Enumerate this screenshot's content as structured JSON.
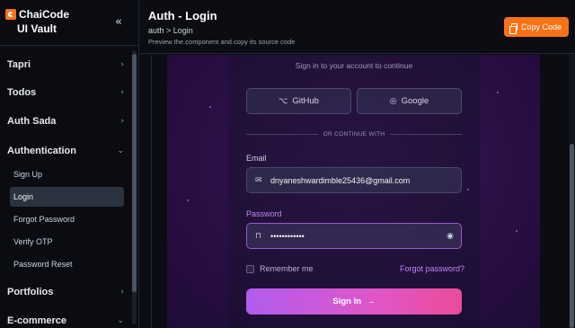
{
  "sidebar": {
    "brand_name": "ChaiCode",
    "brand_sub": "UI Vault",
    "collapse_icon": "«",
    "sections": [
      {
        "label": "Tapri",
        "chevron": "›"
      },
      {
        "label": "Todos",
        "chevron": "›"
      },
      {
        "label": "Auth Sada",
        "chevron": "›"
      },
      {
        "label": "Authentication",
        "chevron": "⌄"
      },
      {
        "label": "Portfolios",
        "chevron": "›"
      },
      {
        "label": "E-commerce",
        "chevron": "⌄"
      }
    ],
    "auth_items": [
      {
        "label": "Sign Up"
      },
      {
        "label": "Login",
        "active": true
      },
      {
        "label": "Forgot Password"
      },
      {
        "label": "Verify OTP"
      },
      {
        "label": "Password Reset"
      }
    ]
  },
  "header": {
    "title": "Auth - Login",
    "breadcrumb": "auth > Login",
    "description": "Preview the component and copy its source code",
    "copy_label": "Copy Code",
    "accent": "#f97316"
  },
  "login": {
    "subtitle": "Sign in to your account to continue",
    "github_label": "GitHub",
    "google_label": "Google",
    "divider_text": "OR CONTINUE WITH",
    "email_label": "Email",
    "email_value": "dnyaneshwardimble25436@gmail.com",
    "password_label": "Password",
    "password_value": "••••••••••••",
    "remember_label": "Remember me",
    "forgot_label": "Forgot password?",
    "signin_label": "Sign In",
    "signin_arrow": "→",
    "colors": {
      "label_email": "#d1d5db",
      "label_password": "#c084fc",
      "button_gradient_start": "#b15cf0",
      "button_gradient_end": "#ea4c9a"
    }
  }
}
